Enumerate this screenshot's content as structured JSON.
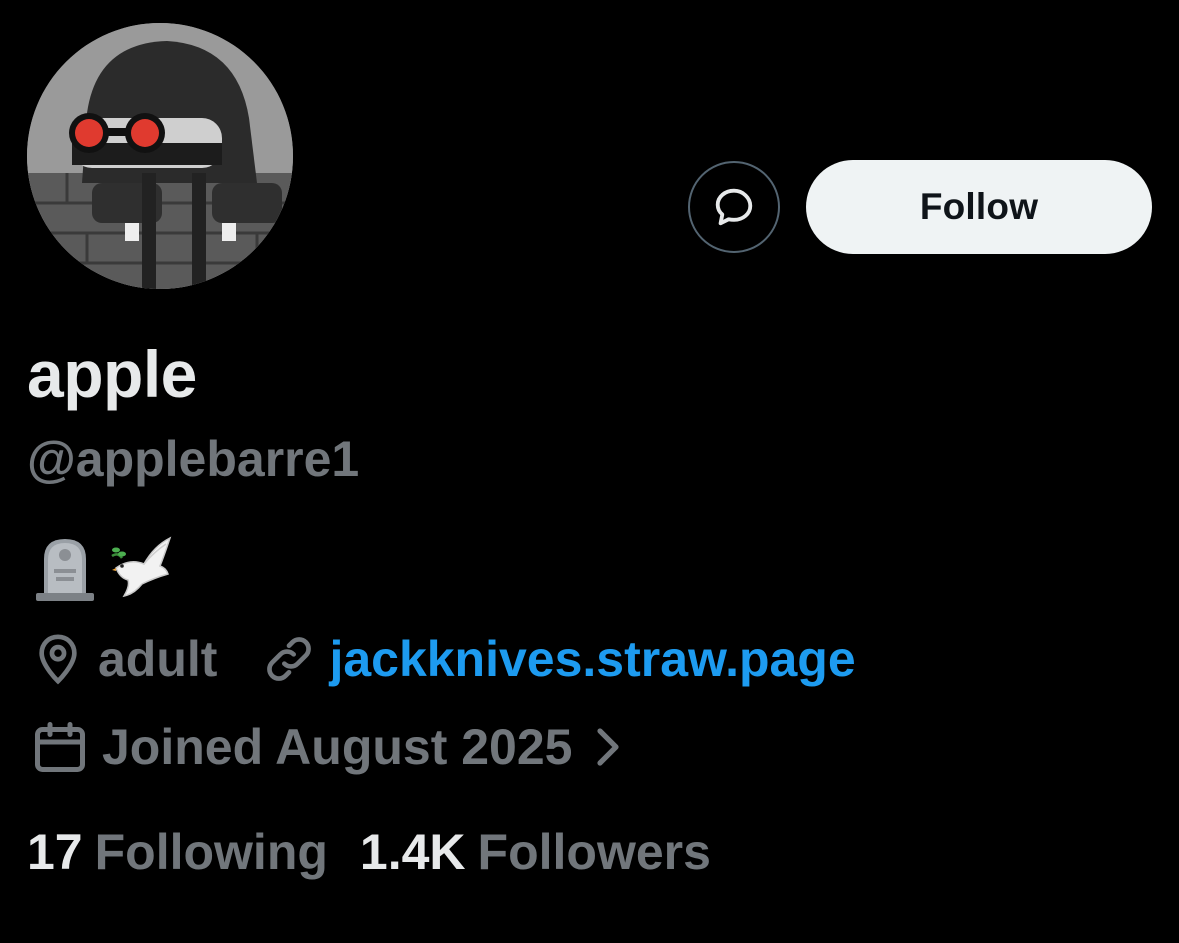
{
  "profile": {
    "display_name": "apple",
    "handle": "@applebarre1",
    "avatar_icon": "avatar-character-icon",
    "bio_emojis": [
      "headstone",
      "dove"
    ],
    "location": "adult",
    "link": "jackknives.straw.page",
    "joined": "Joined August 2025"
  },
  "actions": {
    "message_icon": "chat-bubble-icon",
    "follow_label": "Follow"
  },
  "stats": {
    "following_count": "17",
    "following_label": "Following",
    "followers_count": "1.4K",
    "followers_label": "Followers"
  },
  "colors": {
    "background": "#000000",
    "primary_text": "#e7e9ea",
    "secondary_text": "#71767b",
    "link": "#1d9bf0",
    "follow_button_bg": "#eff3f4",
    "follow_button_text": "#0f1419",
    "border": "#536471"
  }
}
